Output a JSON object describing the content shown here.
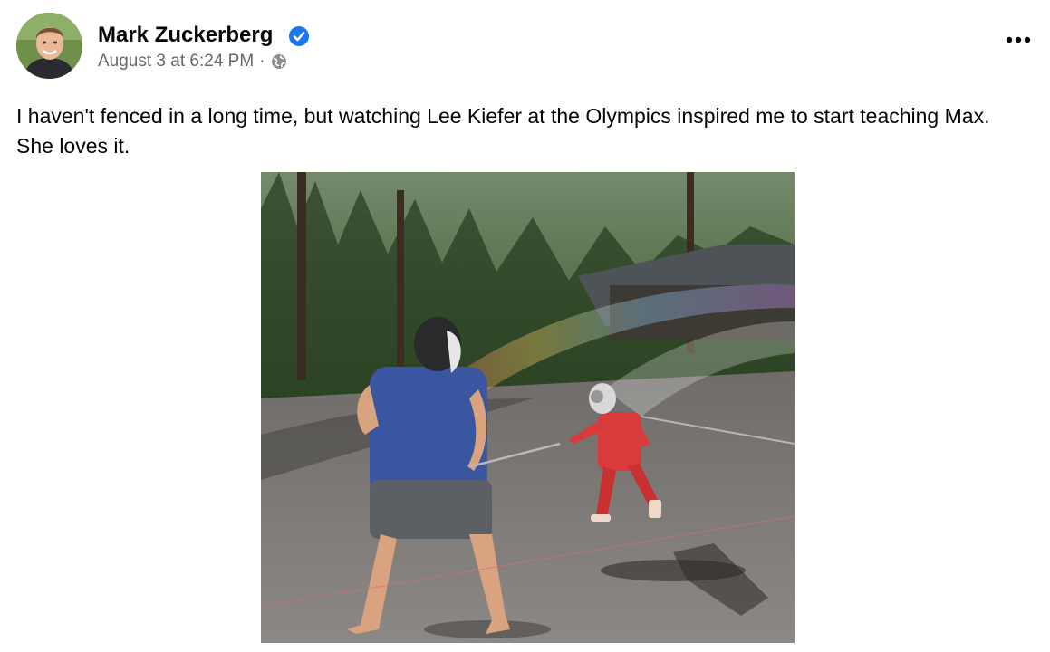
{
  "post": {
    "author": "Mark Zuckerberg",
    "date": "August 3 at 6:24 PM",
    "separator": "·",
    "privacy_icon": "globe-icon",
    "verified_icon": "verified-badge-icon",
    "more_icon": "more-options-icon",
    "text": "I haven't fenced in a long time, but watching Lee Kiefer at the Olympics inspired me to start teaching Max. She loves it."
  },
  "colors": {
    "text_primary": "#050505",
    "text_secondary": "#65676b",
    "verified_blue": "#1877f2"
  }
}
